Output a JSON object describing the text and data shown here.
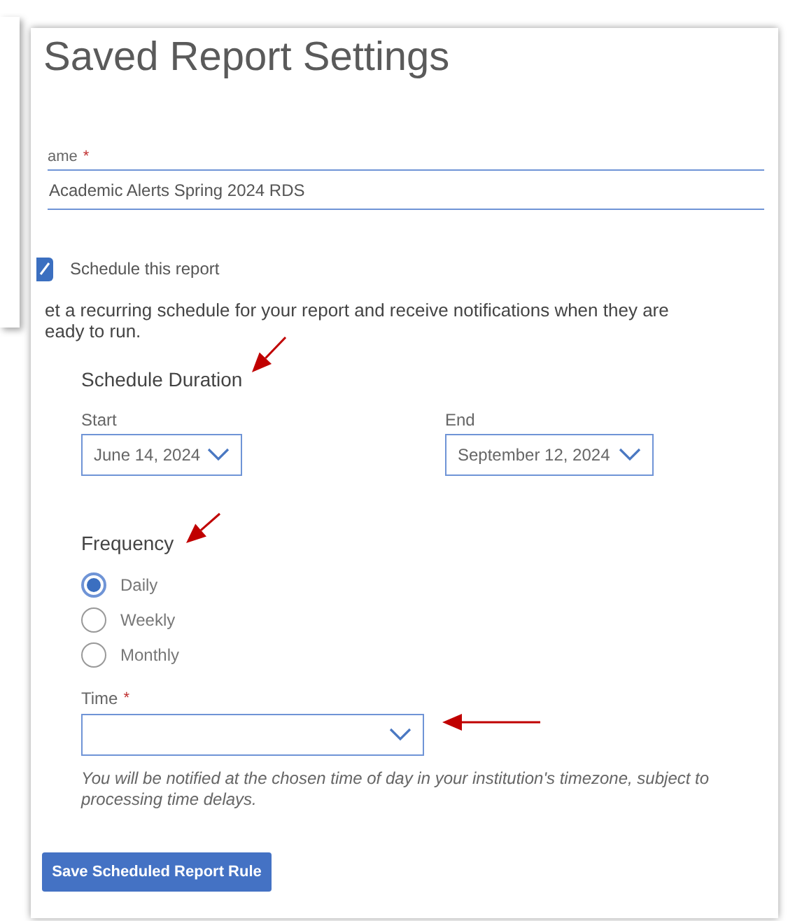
{
  "title": "Saved Report Settings",
  "name_field": {
    "label": "ame",
    "required_mark": "*",
    "value": "Academic Alerts Spring 2024 RDS"
  },
  "schedule_checkbox": {
    "label": "Schedule this report",
    "checked": true
  },
  "description_lines": [
    "et a recurring schedule for your report and receive notifications when they are",
    "eady to run."
  ],
  "schedule_duration": {
    "heading": "Schedule Duration",
    "start": {
      "label": "Start",
      "value": "June 14, 2024"
    },
    "end": {
      "label": "End",
      "value": "September 12, 2024"
    }
  },
  "frequency": {
    "heading": "Frequency",
    "options": [
      {
        "label": "Daily",
        "selected": true
      },
      {
        "label": "Weekly",
        "selected": false
      },
      {
        "label": "Monthly",
        "selected": false
      }
    ]
  },
  "time": {
    "label": "Time",
    "required_mark": "*",
    "hint": "You will be notified at the chosen time of day in your institution's timezone, subject to processing time delays."
  },
  "save_button": "Save Scheduled Report Rule"
}
